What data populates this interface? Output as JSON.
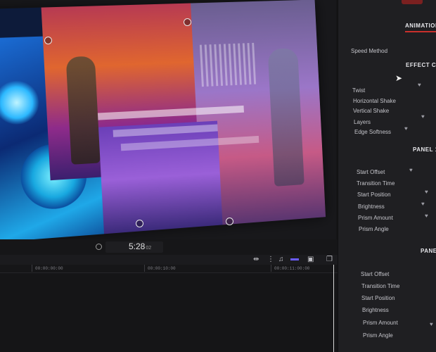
{
  "viewer": {
    "timecode": "5:28",
    "timecode_suffix": "02"
  },
  "timeline": {
    "ruler_labels": [
      "00:00:00:00",
      "00:00:10:00",
      "00:00:11:00:00"
    ]
  },
  "inspector": {
    "tab_animation": "ANIMATION",
    "speed_method_label": "Speed Method",
    "section_effect": "EFFECT C",
    "effect_params": [
      "Twist",
      "Horizontal Shake",
      "Vertical Shake",
      "Layers",
      "Edge Softness"
    ],
    "section_panel1": "PANEL 1",
    "panel1_params": [
      "Start Offset",
      "Transition Time",
      "Start Position",
      "Brightness",
      "Prism Amount",
      "Prism Angle"
    ],
    "section_panel2": "PANE",
    "panel2_params": [
      "Start Offset",
      "Transition Time",
      "Start Position",
      "Brightness",
      "Prism Amount",
      "Prism Angle"
    ]
  },
  "colors": {
    "accent_red": "#c9302c",
    "accent_purple": "#6a5cff",
    "panel_bg": "#1f1f22"
  },
  "icons": [
    "play-icon",
    "expand-icon",
    "audio-icon",
    "headphones-icon",
    "clip-icon",
    "skimming-icon",
    "snap-icon",
    "mouse-cursor-icon",
    "keyframe-icon"
  ]
}
